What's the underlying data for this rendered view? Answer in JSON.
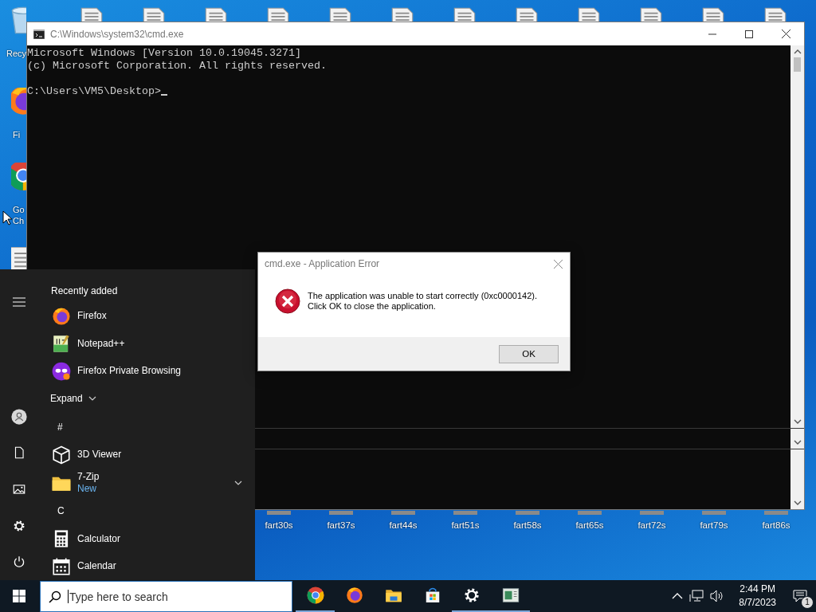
{
  "desktop": {
    "top_icons": [
      {
        "kind": "document"
      },
      {
        "kind": "document"
      },
      {
        "kind": "document"
      },
      {
        "kind": "document"
      },
      {
        "kind": "document"
      },
      {
        "kind": "document"
      },
      {
        "kind": "document"
      },
      {
        "kind": "document"
      },
      {
        "kind": "document"
      },
      {
        "kind": "document"
      },
      {
        "kind": "document"
      },
      {
        "kind": "document"
      }
    ],
    "left_icons": [
      {
        "kind": "recycle-bin",
        "label_lines": [
          "Recy"
        ]
      },
      {
        "kind": "firefox",
        "label_lines": [
          "Fi"
        ]
      },
      {
        "kind": "chrome",
        "label_lines": [
          "Go",
          "Ch"
        ]
      },
      {
        "kind": "document"
      }
    ],
    "bottom_icons": [
      {
        "label": "fart30s"
      },
      {
        "label": "fart37s"
      },
      {
        "label": "fart44s"
      },
      {
        "label": "fart51s"
      },
      {
        "label": "fart58s"
      },
      {
        "label": "fart65s"
      },
      {
        "label": "fart72s"
      },
      {
        "label": "fart79s"
      },
      {
        "label": "fart86s"
      }
    ]
  },
  "cmd_window": {
    "title": "C:\\Windows\\system32\\cmd.exe",
    "output_lines": [
      "Microsoft Windows [Version 10.0.19045.3271]",
      "(c) Microsoft Corporation. All rights reserved."
    ],
    "prompt": "C:\\Users\\VM5\\Desktop>"
  },
  "dialog": {
    "title": "cmd.exe - Application Error",
    "message_lines": [
      "The application was unable to start correctly (0xc0000142).",
      "Click OK to close the application."
    ],
    "button": "OK"
  },
  "start_menu": {
    "rail": [
      {
        "kind": "user"
      },
      {
        "kind": "documents"
      },
      {
        "kind": "pictures"
      },
      {
        "kind": "settings"
      },
      {
        "kind": "power"
      }
    ],
    "recent_heading": "Recently added",
    "recent": [
      {
        "name": "Firefox",
        "kind": "firefox"
      },
      {
        "name": "Notepad++",
        "kind": "notepad"
      },
      {
        "name": "Firefox Private Browsing",
        "kind": "private"
      }
    ],
    "expand": "Expand",
    "groups": [
      {
        "letter": "#",
        "apps": [
          {
            "name": "3D Viewer",
            "kind": "cube",
            "expandable": false
          },
          {
            "name": "7-Zip",
            "kind": "folder",
            "badge": "New",
            "expandable": true
          }
        ]
      },
      {
        "letter": "C",
        "apps": [
          {
            "name": "Calculator",
            "kind": "calculator",
            "expandable": false
          },
          {
            "name": "Calendar",
            "kind": "calendar",
            "expandable": false
          }
        ]
      }
    ]
  },
  "taskbar": {
    "search": {
      "placeholder": "Type here to search"
    },
    "apps": [
      {
        "kind": "chrome",
        "running": true
      },
      {
        "kind": "firefox",
        "running": false
      },
      {
        "kind": "explorer",
        "running": false
      },
      {
        "kind": "store",
        "running": false
      },
      {
        "kind": "settings",
        "running": true
      },
      {
        "kind": "app-window",
        "running": true
      }
    ],
    "time": "2:44 PM",
    "date": "8/7/2023",
    "notification_count": "1"
  }
}
